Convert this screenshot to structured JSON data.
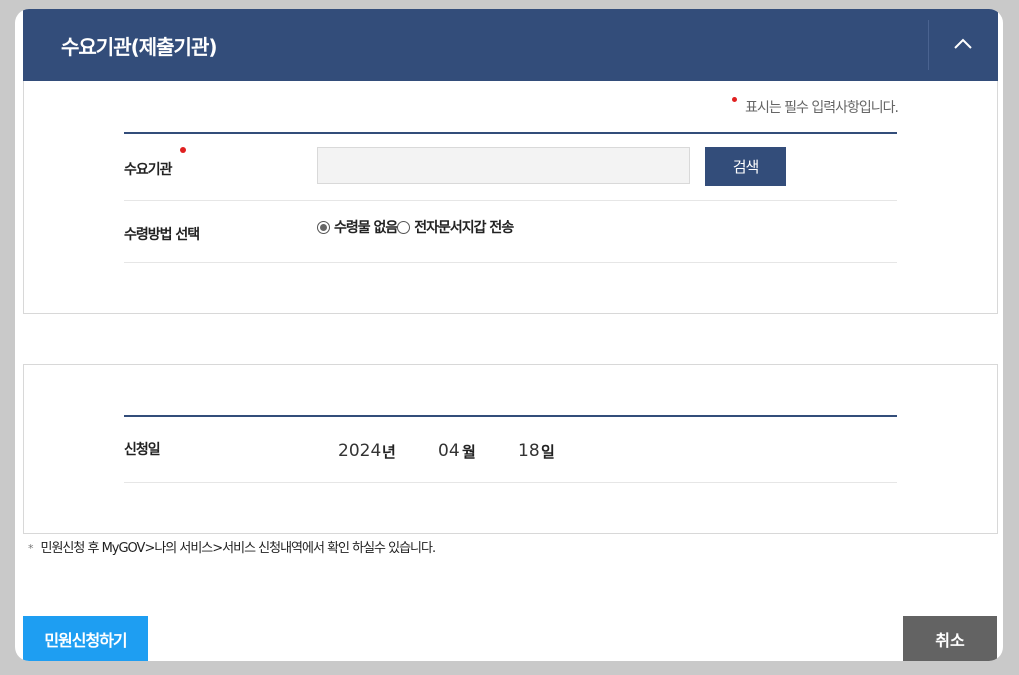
{
  "header": {
    "title": "수요기관(제출기관)",
    "collapse_icon": "chevron-up-icon"
  },
  "required_note": "표시는 필수 입력사항입니다.",
  "agency": {
    "label": "수요기관",
    "input_value": "",
    "search_label": "검색"
  },
  "receive": {
    "label": "수령방법 선택",
    "options": [
      "수령물 없음",
      "전자문서지갑 전송"
    ],
    "selected": "수령물 없음"
  },
  "apply_date": {
    "label": "신청일",
    "year": "2024",
    "year_unit": "년",
    "month": "04",
    "month_unit": "월",
    "day": "18",
    "day_unit": "일"
  },
  "notice": "민원신청 후 MyGOV>나의 서비스>서비스 신청내역에서 확인 하실수 있습니다.",
  "buttons": {
    "apply": "민원신청하기",
    "cancel": "취소"
  },
  "colors": {
    "header": "#334d7a",
    "apply": "#1e9ef2",
    "cancel": "#636363",
    "required": "#e02020"
  }
}
